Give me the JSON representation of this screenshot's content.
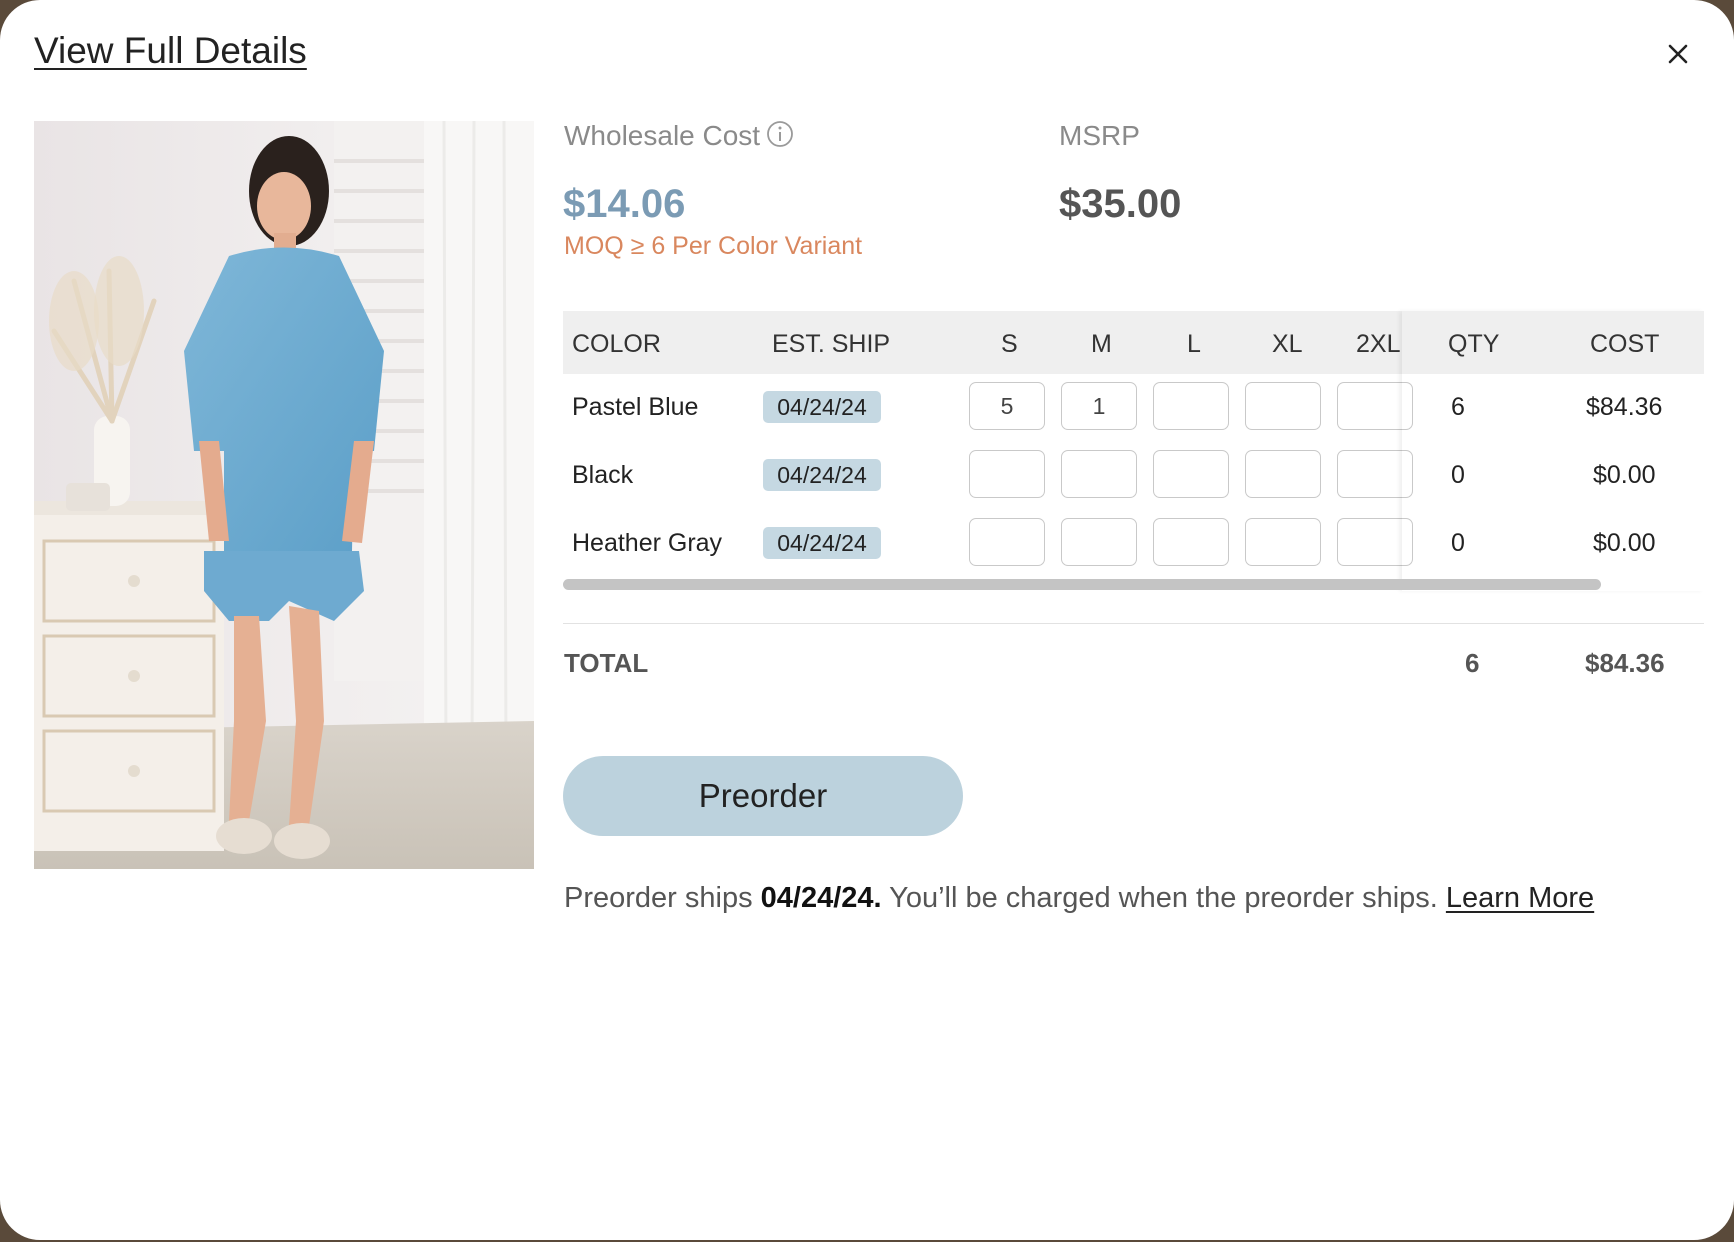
{
  "header": {
    "view_full_details": "View Full Details"
  },
  "icons": {
    "close": "close-icon",
    "info": "info-icon"
  },
  "pricing": {
    "wholesale_label": "Wholesale Cost",
    "wholesale_price": "$14.06",
    "moq": "MOQ ≥ 6 Per Color Variant",
    "msrp_label": "MSRP",
    "msrp_price": "$35.00"
  },
  "table": {
    "headers": {
      "color": "COLOR",
      "est_ship": "EST. SHIP",
      "sizes": [
        "S",
        "M",
        "L",
        "XL",
        "2XL"
      ],
      "qty": "QTY",
      "cost": "COST"
    },
    "rows": [
      {
        "color": "Pastel Blue",
        "ship": "04/24/24",
        "sizes": [
          "5",
          "1",
          "",
          "",
          ""
        ],
        "qty": "6",
        "cost": "$84.36"
      },
      {
        "color": "Black",
        "ship": "04/24/24",
        "sizes": [
          "",
          "",
          "",
          "",
          ""
        ],
        "qty": "0",
        "cost": "$0.00"
      },
      {
        "color": "Heather Gray",
        "ship": "04/24/24",
        "sizes": [
          "",
          "",
          "",
          "",
          ""
        ],
        "qty": "0",
        "cost": "$0.00"
      }
    ]
  },
  "totals": {
    "label": "TOTAL",
    "qty": "6",
    "cost": "$84.36"
  },
  "actions": {
    "preorder_label": "Preorder"
  },
  "note": {
    "prefix": "Preorder ships ",
    "date": "04/24/24.",
    "suffix": " You’ll be charged when the preorder ships. ",
    "learn_more": "Learn More"
  },
  "colors": {
    "wholesale_price": "#7b9bb4",
    "moq": "#d9875e",
    "preorder_button": "#bcd2dd",
    "ship_badge": "#c5d8e2"
  }
}
